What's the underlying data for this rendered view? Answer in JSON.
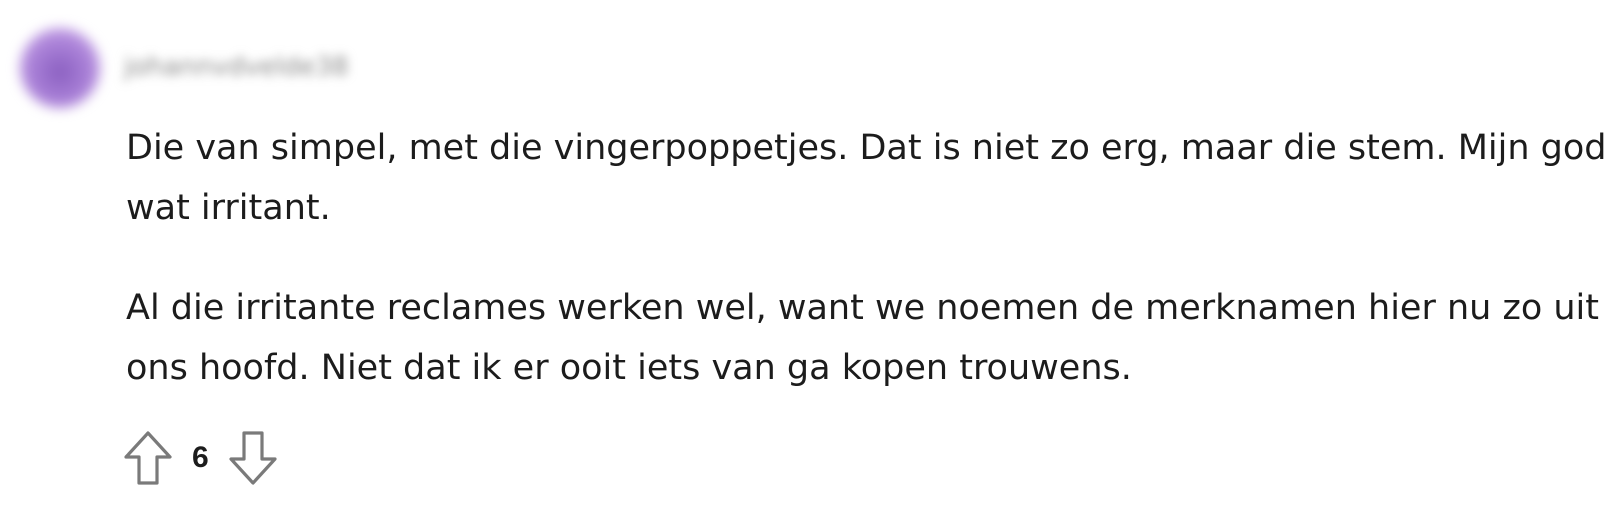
{
  "comment": {
    "username": "johannvdvelde38",
    "avatar_color": "#a77ed6",
    "paragraphs": [
      "Die van simpel, met die vingerpoppetjes. Dat is niet zo erg, maar die stem. Mijn god wat irritant.",
      "Al die irritante reclames werken wel, want we noemen de merknamen hier nu zo uit ons hoofd. Niet dat ik er ooit iets van ga kopen trouwens."
    ],
    "score": "6",
    "icons": {
      "upvote": "upvote-arrow-icon",
      "downvote": "downvote-arrow-icon"
    }
  }
}
